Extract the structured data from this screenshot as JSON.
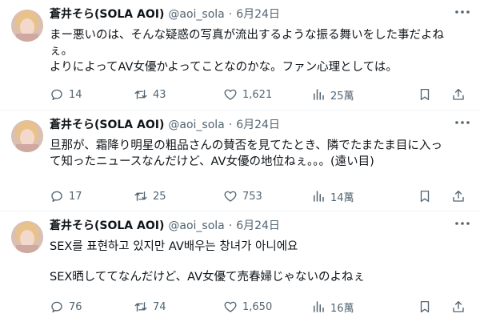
{
  "tweets": [
    {
      "name": "蒼井そら(SOLA AOI)",
      "handle": "@aoi_sola",
      "dot": "·",
      "date": "6月24日",
      "lines": [
        "まー悪いのは、そんな疑惑の写真が流出するような振る舞いをした事だよね",
        "ぇ。",
        "よりによってAV女優かよってことなのかな。ファン心理としては。"
      ],
      "replies": "14",
      "retweets": "43",
      "likes": "1,621",
      "views": "25萬"
    },
    {
      "name": "蒼井そら(SOLA AOI)",
      "handle": "@aoi_sola",
      "dot": "·",
      "date": "6月24日",
      "lines": [
        "旦那が、霜降り明星の粗品さんの賛否を見てたとき、隣でたまたま目に入っ",
        "て知ったニュースなんだけど、AV女優の地位ねぇ。。。(遠い目)"
      ],
      "replies": "17",
      "retweets": "25",
      "likes": "753",
      "views": "14萬"
    },
    {
      "name": "蒼井そら(SOLA AOI)",
      "handle": "@aoi_sola",
      "dot": "·",
      "date": "6月24日",
      "lines": [
        "SEX를 표현하고 있지만 AV배우는 창녀가 아니에요",
        "SEX晒しててなんだけど、AV女優て売春婦じゃないのよねぇ"
      ],
      "replies": "76",
      "retweets": "74",
      "likes": "1,650",
      "views": "16萬"
    }
  ],
  "icons": {
    "reply": "reply-icon",
    "retweet": "retweet-icon",
    "like": "heart-icon",
    "views": "views-icon",
    "bookmark": "bookmark-icon",
    "share": "share-icon",
    "more": "more-icon"
  },
  "colors": {
    "text": "#0f1419",
    "secondary": "#536471",
    "divider": "#eff3f4"
  }
}
